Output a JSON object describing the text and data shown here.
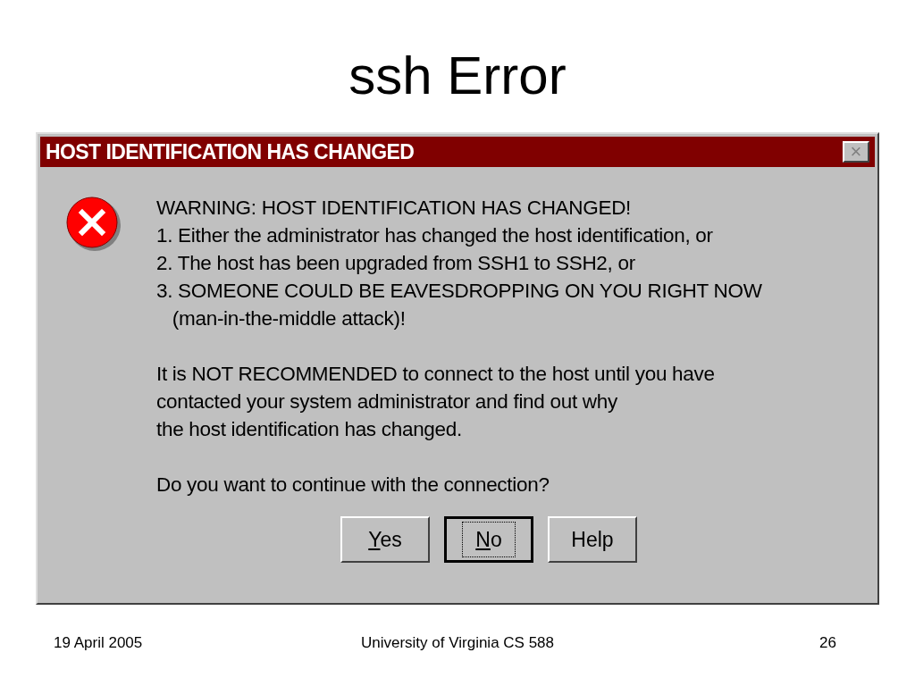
{
  "slide": {
    "title": "ssh Error"
  },
  "dialog": {
    "title": "HOST IDENTIFICATION HAS CHANGED",
    "close": "×",
    "paragraphs": [
      [
        "WARNING: HOST IDENTIFICATION HAS CHANGED!",
        "1. Either the administrator has changed the host identification, or",
        "2. The host has been upgraded from SSH1 to SSH2, or",
        "3. SOMEONE COULD BE EAVESDROPPING ON YOU RIGHT NOW",
        "   (man-in-the-middle attack)!"
      ],
      [
        "It is NOT RECOMMENDED to connect to the host until you have",
        "contacted your system administrator and find out why",
        "the host identification has changed."
      ],
      [
        "Do you want to continue with the connection?"
      ]
    ],
    "buttons": [
      {
        "label": "Yes",
        "access_key_underlined": true,
        "default": false
      },
      {
        "label": "No",
        "access_key_underlined": true,
        "default": true
      },
      {
        "label": "Help",
        "access_key_underlined": false,
        "default": false
      }
    ]
  },
  "footer": {
    "date": "19 April 2005",
    "center": "University of Virginia CS 588",
    "page": "26"
  }
}
